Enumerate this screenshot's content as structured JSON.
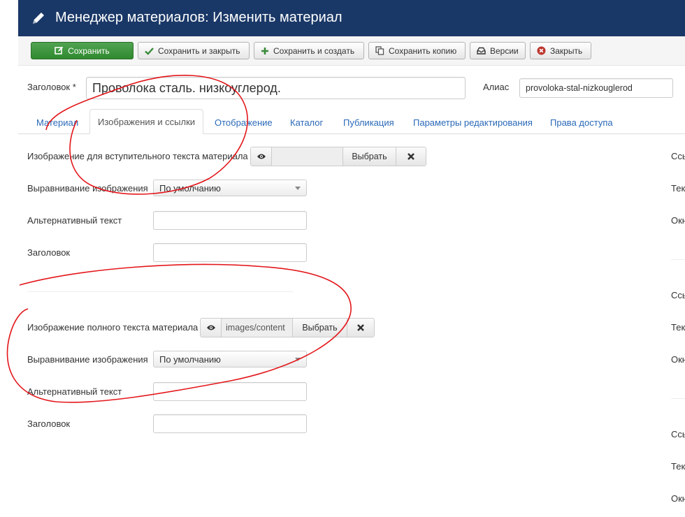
{
  "header": {
    "title": "Менеджер материалов: Изменить материал",
    "icon": "pencil-icon",
    "bg_color": "#1a3867"
  },
  "toolbar": {
    "save": "Сохранить",
    "save_close": "Сохранить и закрыть",
    "save_new": "Сохранить и создать",
    "save_copy": "Сохранить копию",
    "versions": "Версии",
    "close": "Закрыть",
    "save_color": "#3c9a3c"
  },
  "form": {
    "title_label": "Заголовок *",
    "title_value": "Проволока сталь. низкоуглерод.",
    "alias_label": "Алиас",
    "alias_value": "provoloka-stal-nizkouglerod"
  },
  "tabs": [
    {
      "label": "Материал"
    },
    {
      "label": "Изображения и ссылки",
      "active": true
    },
    {
      "label": "Отображение"
    },
    {
      "label": "Каталог"
    },
    {
      "label": "Публикация"
    },
    {
      "label": "Параметры редактирования"
    },
    {
      "label": "Права доступа"
    }
  ],
  "intro_image": {
    "label": "Изображение для вступительного текста материала",
    "path": "",
    "select_label": "Выбрать",
    "align_label": "Выравнивание изображения",
    "align_value": "По умолчанию",
    "alt_label": "Альтернативный текст",
    "caption_label": "Заголовок"
  },
  "full_image": {
    "label": "Изображение полного текста материала",
    "path": "images/content",
    "select_label": "Выбрать",
    "align_label": "Выравнивание изображения",
    "align_value": "По умолчанию",
    "alt_label": "Альтернативный текст",
    "caption_label": "Заголовок"
  },
  "right_column": {
    "link_a": {
      "url": "Ссы",
      "text": "Тек",
      "window": "Окн"
    },
    "link_b": {
      "url": "Ссы",
      "text": "Тек",
      "window": "Окн"
    },
    "link_c": {
      "url": "Ссы",
      "text": "Тек",
      "window": "Окн"
    }
  },
  "annotation_color": "#e3171b"
}
